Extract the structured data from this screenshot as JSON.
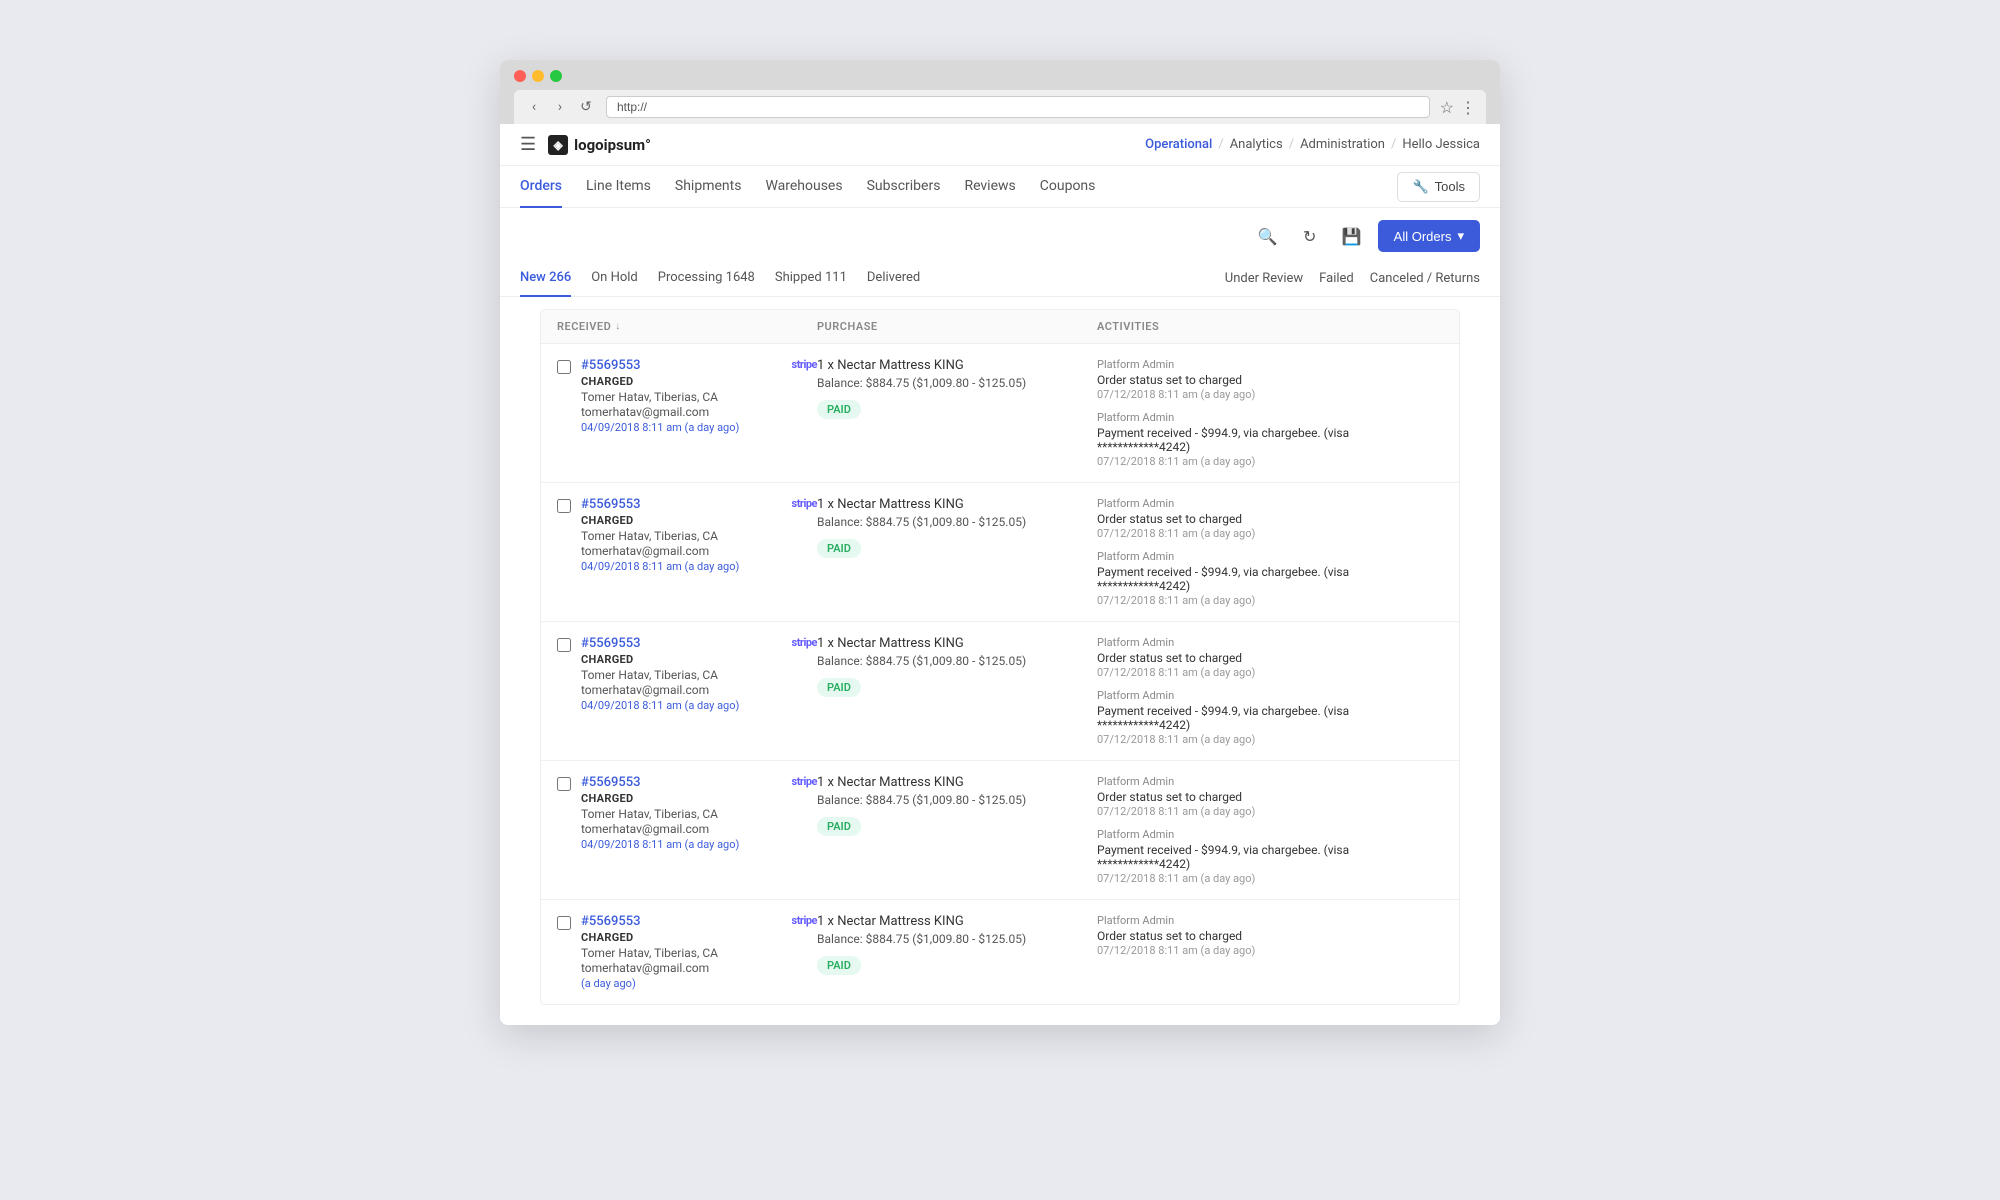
{
  "browser": {
    "url": "http://",
    "traffic_lights": [
      "red",
      "yellow",
      "green"
    ]
  },
  "top_nav": {
    "logo_text": "logoipsum°",
    "links": {
      "operational": "Operational",
      "analytics": "Analytics",
      "administration": "Administration",
      "hello": "Hello Jessica"
    }
  },
  "main_nav": {
    "items": [
      {
        "label": "Orders",
        "active": true
      },
      {
        "label": "Line Items",
        "active": false
      },
      {
        "label": "Shipments",
        "active": false
      },
      {
        "label": "Warehouses",
        "active": false
      },
      {
        "label": "Subscribers",
        "active": false
      },
      {
        "label": "Reviews",
        "active": false
      },
      {
        "label": "Coupons",
        "active": false
      }
    ],
    "tools_label": "Tools"
  },
  "order_tabs": {
    "tabs": [
      {
        "label": "New 266",
        "active": true
      },
      {
        "label": "On Hold",
        "active": false
      },
      {
        "label": "Processing 1648",
        "active": false
      },
      {
        "label": "Shipped 111",
        "active": false
      },
      {
        "label": "Delivered",
        "active": false
      }
    ],
    "right_tabs": [
      {
        "label": "Under Review"
      },
      {
        "label": "Failed"
      },
      {
        "label": "Canceled / Returns"
      }
    ],
    "all_orders_label": "All Orders"
  },
  "table": {
    "headers": [
      {
        "label": "RECEIVED",
        "sortable": true
      },
      {
        "label": "PURCHASE",
        "sortable": false
      },
      {
        "label": "ACTIVITIES",
        "sortable": false
      }
    ],
    "rows": [
      {
        "id": "#5569553",
        "status": "CHARGED",
        "customer": "Tomer Hatav, Tiberias, CA",
        "email": "tomerhatav@gmail.com",
        "date": "04/09/2018 8:11 am (a day ago)",
        "payment_processor": "stripe",
        "product": "1 x Nectar Mattress KING",
        "balance": "Balance: $884.75 ($1,009.80 - $125.05)",
        "paid_label": "PAID",
        "activities": [
          {
            "admin": "Platform Admin",
            "text": "Order status set to charged",
            "date": "07/12/2018 8:11 am (a day ago)"
          },
          {
            "admin": "Platform Admin",
            "text": "Payment received - $994.9, via chargebee. (visa ************4242)",
            "date": "07/12/2018 8:11 am (a day ago)"
          }
        ]
      },
      {
        "id": "#5569553",
        "status": "CHARGED",
        "customer": "Tomer Hatav, Tiberias, CA",
        "email": "tomerhatav@gmail.com",
        "date": "04/09/2018 8:11 am (a day ago)",
        "payment_processor": "stripe",
        "product": "1 x Nectar Mattress KING",
        "balance": "Balance: $884.75 ($1,009.80 - $125.05)",
        "paid_label": "PAID",
        "activities": [
          {
            "admin": "Platform Admin",
            "text": "Order status set to charged",
            "date": "07/12/2018 8:11 am (a day ago)"
          },
          {
            "admin": "Platform Admin",
            "text": "Payment received - $994.9, via chargebee. (visa ************4242)",
            "date": "07/12/2018 8:11 am (a day ago)"
          }
        ]
      },
      {
        "id": "#5569553",
        "status": "CHARGED",
        "customer": "Tomer Hatav, Tiberias, CA",
        "email": "tomerhatav@gmail.com",
        "date": "04/09/2018 8:11 am (a day ago)",
        "payment_processor": "stripe",
        "product": "1 x Nectar Mattress KING",
        "balance": "Balance: $884.75 ($1,009.80 - $125.05)",
        "paid_label": "PAID",
        "activities": [
          {
            "admin": "Platform Admin",
            "text": "Order status set to charged",
            "date": "07/12/2018 8:11 am (a day ago)"
          },
          {
            "admin": "Platform Admin",
            "text": "Payment received - $994.9, via chargebee. (visa ************4242)",
            "date": "07/12/2018 8:11 am (a day ago)"
          }
        ]
      },
      {
        "id": "#5569553",
        "status": "CHARGED",
        "customer": "Tomer Hatav, Tiberias, CA",
        "email": "tomerhatav@gmail.com",
        "date": "04/09/2018 8:11 am (a day ago)",
        "payment_processor": "stripe",
        "product": "1 x Nectar Mattress KING",
        "balance": "Balance: $884.75 ($1,009.80 - $125.05)",
        "paid_label": "PAID",
        "activities": [
          {
            "admin": "Platform Admin",
            "text": "Order status set to charged",
            "date": "07/12/2018 8:11 am (a day ago)"
          },
          {
            "admin": "Platform Admin",
            "text": "Payment received - $994.9, via chargebee. (visa ************4242)",
            "date": "07/12/2018 8:11 am (a day ago)"
          }
        ]
      },
      {
        "id": "#5569553",
        "status": "CHARGED",
        "customer": "Tomer Hatav, Tiberias, CA",
        "email": "tomerhatav@gmail.com",
        "date": "(a day ago)",
        "payment_processor": "stripe",
        "product": "1 x Nectar Mattress KING",
        "balance": "Balance: $884.75 ($1,009.80 - $125.05)",
        "paid_label": "PAID",
        "activities": [
          {
            "admin": "Platform Admin",
            "text": "Order status set to charged",
            "date": "07/12/2018 8:11 am (a day ago)"
          }
        ]
      }
    ]
  },
  "icons": {
    "search": "🔍",
    "refresh": "↻",
    "save": "💾",
    "chevron_down": "▾",
    "sort_down": "↓",
    "wrench": "🔧",
    "hamburger": "☰",
    "back": "‹",
    "forward": "›",
    "reload": "↺",
    "star": "☆",
    "more": "⋮"
  }
}
